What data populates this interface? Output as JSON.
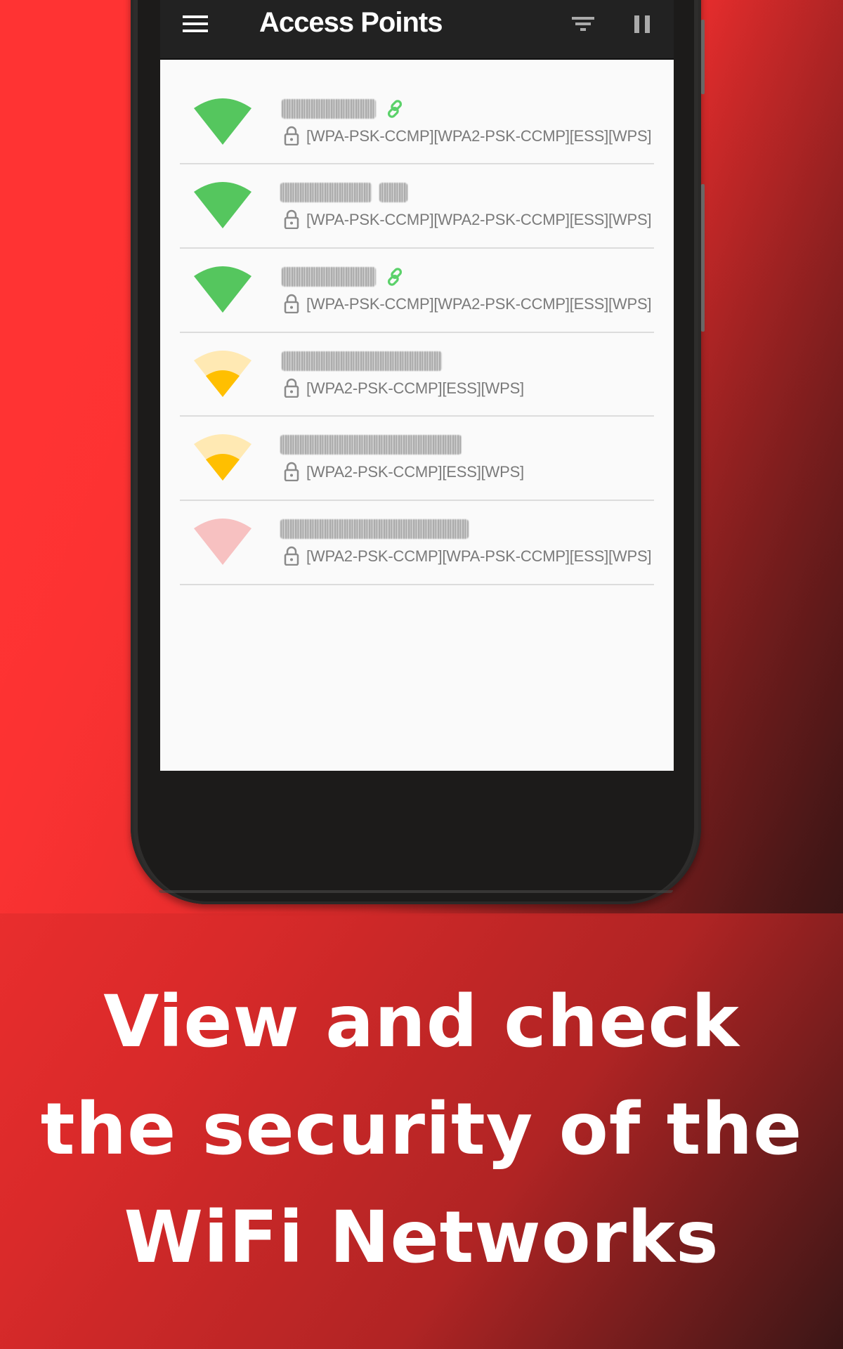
{
  "app_bar": {
    "title": "Access Points",
    "menu_icon": "hamburger-menu-icon",
    "filter_icon": "filter-icon",
    "pause_icon": "pause-icon"
  },
  "access_points": [
    {
      "ssid": "[blurred]",
      "connected": true,
      "signal": "strong",
      "signal_color": "#55c65e",
      "security": "[WPA-PSK-CCMP][WPA2-PSK-CCMP][ESS][WPS]"
    },
    {
      "ssid": "[blurred]",
      "connected": false,
      "signal": "strong",
      "signal_color": "#55c65e",
      "security": "[WPA-PSK-CCMP][WPA2-PSK-CCMP][ESS][WPS]"
    },
    {
      "ssid": "[blurred]",
      "connected": true,
      "signal": "strong",
      "signal_color": "#55c65e",
      "security": "[WPA-PSK-CCMP][WPA2-PSK-CCMP][ESS][WPS]"
    },
    {
      "ssid": "[blurred]",
      "connected": false,
      "signal": "weak",
      "signal_color": "#ffbf00",
      "security": "[WPA2-PSK-CCMP][ESS][WPS]"
    },
    {
      "ssid": "[blurred]",
      "connected": false,
      "signal": "weak",
      "signal_color": "#ffbf00",
      "security": "[WPA2-PSK-CCMP][ESS][WPS]"
    },
    {
      "ssid": "[blurred]",
      "connected": false,
      "signal": "none",
      "signal_color": "#f7c1c1",
      "security": "[WPA2-PSK-CCMP][WPA-PSK-CCMP][ESS][WPS]"
    }
  ],
  "caption": {
    "line1": "View and check",
    "line2": "the security of the",
    "line3": "WiFi Networks"
  },
  "colors": {
    "background_red": "#ff3333",
    "app_bar": "#222222",
    "screen_bg": "#fafafa",
    "strong_signal": "#55c65e",
    "medium_signal": "#ffbf00",
    "medium_signal_faded": "#ffe9b3",
    "weak_signal_faded": "#f7c1c1",
    "link_green": "#5bd16a",
    "security_text": "#7a7a7a"
  }
}
